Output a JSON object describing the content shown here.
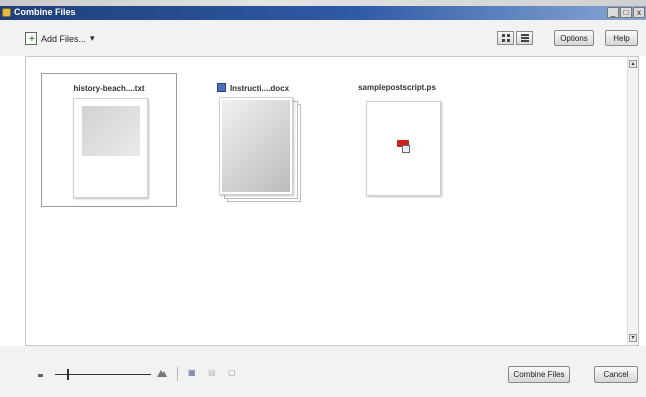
{
  "window": {
    "title": "Combine Files",
    "controls": [
      "_",
      "□",
      "x"
    ]
  },
  "toolbar": {
    "add_files_label": "Add Files...",
    "add_files_caret": "▾",
    "options_label": "Options",
    "help_label": "Help"
  },
  "files": [
    {
      "name": "history-beach....txt",
      "selected": true
    },
    {
      "name": "Instructi....docx",
      "selected": false,
      "badge": "word"
    },
    {
      "name": "samplepostscript.ps",
      "selected": false
    }
  ],
  "bottom": {
    "combine_label": "Combine Files",
    "cancel_label": "Cancel",
    "zoom_level": 0.12
  }
}
